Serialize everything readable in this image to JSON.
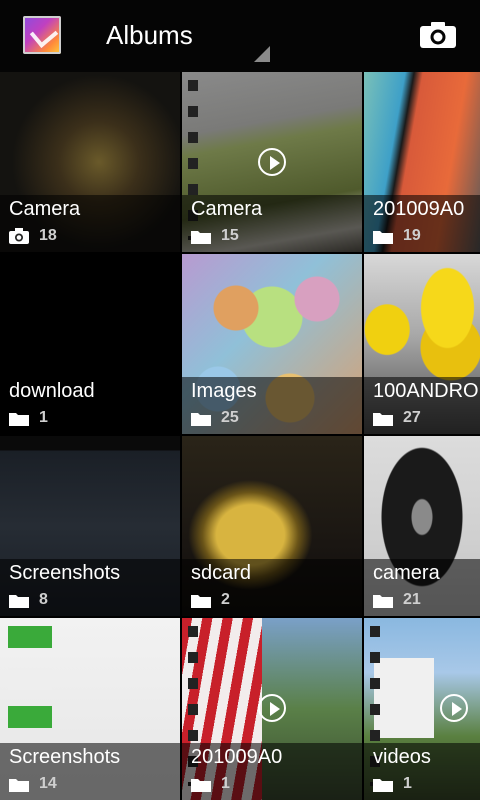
{
  "app": {
    "title": "Albums"
  },
  "albums": [
    {
      "name": "Camera",
      "count": "18",
      "source": "camera"
    },
    {
      "name": "Camera",
      "count": "15",
      "source": "folder"
    },
    {
      "name": "201009A0",
      "count": "19",
      "source": "folder"
    },
    {
      "name": "download",
      "count": "1",
      "source": "folder"
    },
    {
      "name": "Images",
      "count": "25",
      "source": "folder"
    },
    {
      "name": "100ANDRO",
      "count": "27",
      "source": "folder"
    },
    {
      "name": "Screenshots",
      "count": "8",
      "source": "folder"
    },
    {
      "name": "sdcard",
      "count": "2",
      "source": "folder"
    },
    {
      "name": "camera",
      "count": "21",
      "source": "folder"
    },
    {
      "name": "Screenshots",
      "count": "14",
      "source": "folder"
    },
    {
      "name": "201009A0",
      "count": "1",
      "source": "folder"
    },
    {
      "name": "videos",
      "count": "1",
      "source": "folder"
    }
  ]
}
